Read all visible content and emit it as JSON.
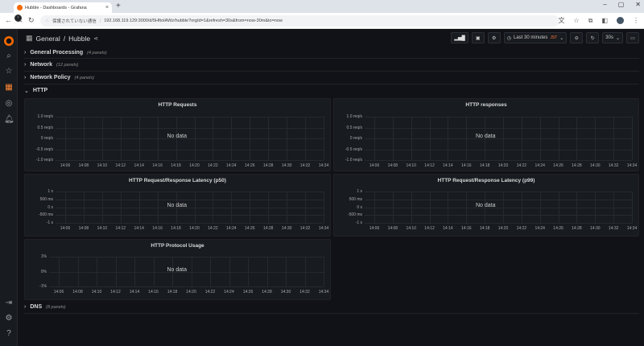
{
  "browser": {
    "tab_title": "Hubble - Dashboards - Grafana",
    "security_warning": "保護されていない通信",
    "url": "192.168.119.129:3000/d/5HftoIAWz/hubble?orgId=1&refresh=30s&from=now-30m&to=now"
  },
  "header": {
    "folder": "General",
    "separator": "/",
    "dashboard": "Hubble"
  },
  "toolbar": {
    "time_range": "Last 30 minutes",
    "timezone": "JST",
    "refresh": "30s"
  },
  "rows": [
    {
      "title": "General Processing",
      "count": "(4 panels)",
      "collapsed": true
    },
    {
      "title": "Network",
      "count": "(12 panels)",
      "collapsed": true
    },
    {
      "title": "Network Policy",
      "count": "(4 panels)",
      "collapsed": true
    },
    {
      "title": "HTTP",
      "count": "",
      "collapsed": false
    },
    {
      "title": "DNS",
      "count": "(8 panels)",
      "collapsed": true
    }
  ],
  "panels": [
    {
      "title": "HTTP Requests",
      "nodata": "No data",
      "yticks": [
        "1.0 req/s",
        "0.5 req/s",
        "0 req/s",
        "-0.5 req/s",
        "-1.0 req/s"
      ]
    },
    {
      "title": "HTTP responses",
      "nodata": "No data",
      "yticks": [
        "1.0 req/s",
        "0.5 req/s",
        "0 req/s",
        "-0.5 req/s",
        "-1.0 req/s"
      ]
    },
    {
      "title": "HTTP Request/Response Latency (p50)",
      "nodata": "No data",
      "yticks": [
        "1 s",
        "500 ms",
        "0 s",
        "-500 ms",
        "-1 s"
      ]
    },
    {
      "title": "HTTP Request/Response Latency (p99)",
      "nodata": "No data",
      "yticks": [
        "1 s",
        "500 ms",
        "0 s",
        "-500 ms",
        "-1 s"
      ]
    },
    {
      "title": "HTTP Protocol Usage",
      "nodata": "No data",
      "yticks": [
        "1%",
        "0%",
        "-1%"
      ]
    }
  ],
  "xticks": [
    "14:06",
    "14:08",
    "14:10",
    "14:12",
    "14:14",
    "14:16",
    "14:18",
    "14:20",
    "14:22",
    "14:24",
    "14:26",
    "14:28",
    "14:30",
    "14:32",
    "14:34"
  ],
  "colors": {
    "bg": "#111217",
    "panel": "#181b1f",
    "accent": "#f46800",
    "utc_badge": "#ff7a3d"
  }
}
